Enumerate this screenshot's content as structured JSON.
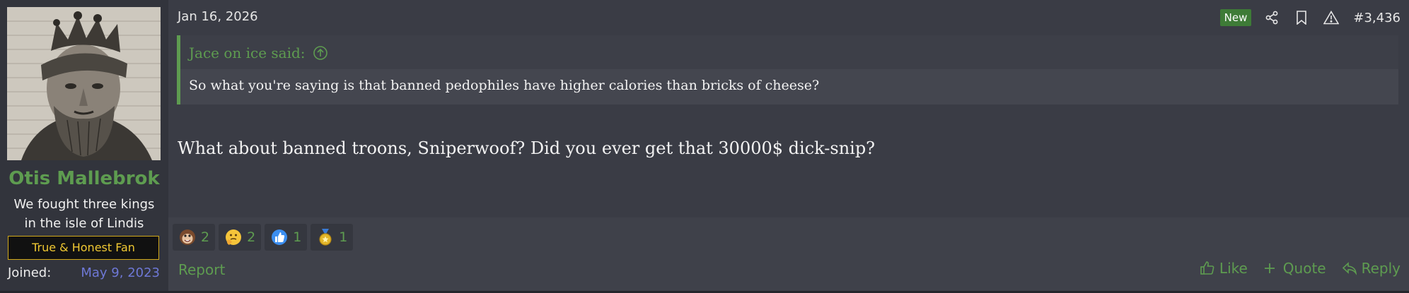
{
  "user": {
    "name": "Otis Mallebrok",
    "title_line1": "We fought three kings",
    "title_line2": "in the isle of Lindis",
    "banner": "True & Honest Fan",
    "joined_label": "Joined:",
    "joined_date": "May 9, 2023"
  },
  "post": {
    "date": "Jan 16, 2026",
    "badge": "New",
    "number": "#3,436",
    "quote": {
      "author": "Jace on ice said:",
      "text": "So what you're saying is that banned pedophiles have higher calories than bricks of cheese?"
    },
    "message": "What about banned troons, Sniperwoof? Did you ever get that 30000$ dick-snip?"
  },
  "reactions": [
    {
      "icon": "monkey-face-icon",
      "count": "2"
    },
    {
      "icon": "thinking-face-icon",
      "count": "2"
    },
    {
      "icon": "thumbs-up-icon",
      "count": "1"
    },
    {
      "icon": "medal-icon",
      "count": "1"
    }
  ],
  "footer": {
    "report": "Report",
    "like": "Like",
    "quote": "Quote",
    "reply": "Reply"
  },
  "colors": {
    "accent": "#5e9c50",
    "joined_date": "#6e78d6",
    "banner_border": "#d1a91b",
    "badge": "#3e7b37"
  }
}
